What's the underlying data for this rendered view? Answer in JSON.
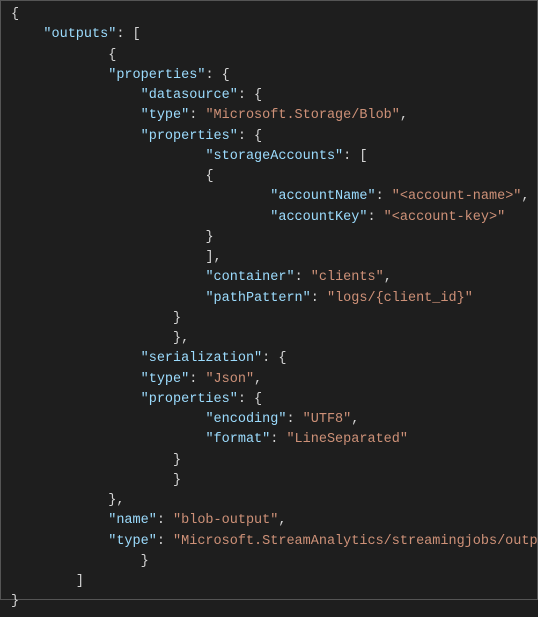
{
  "code": {
    "lines": [
      {
        "indent": 0,
        "tokens": [
          {
            "t": "{",
            "c": "punct"
          }
        ]
      },
      {
        "indent": 1,
        "tokens": [
          {
            "t": "\"outputs\"",
            "c": "key"
          },
          {
            "t": ": [",
            "c": "punct"
          }
        ]
      },
      {
        "indent": 3,
        "tokens": [
          {
            "t": "{",
            "c": "punct"
          }
        ]
      },
      {
        "indent": 3,
        "tokens": [
          {
            "t": "\"properties\"",
            "c": "key"
          },
          {
            "t": ": {",
            "c": "punct"
          }
        ]
      },
      {
        "indent": 4,
        "tokens": [
          {
            "t": "\"datasource\"",
            "c": "key"
          },
          {
            "t": ": {",
            "c": "punct"
          }
        ]
      },
      {
        "indent": 4,
        "tokens": [
          {
            "t": "\"type\"",
            "c": "key"
          },
          {
            "t": ": ",
            "c": "punct"
          },
          {
            "t": "\"Microsoft.Storage/Blob\"",
            "c": "str"
          },
          {
            "t": ",",
            "c": "punct"
          }
        ]
      },
      {
        "indent": 4,
        "tokens": [
          {
            "t": "\"properties\"",
            "c": "key"
          },
          {
            "t": ": {",
            "c": "punct"
          }
        ]
      },
      {
        "indent": 6,
        "tokens": [
          {
            "t": "\"storageAccounts\"",
            "c": "key"
          },
          {
            "t": ": [",
            "c": "punct"
          }
        ]
      },
      {
        "indent": 6,
        "tokens": [
          {
            "t": "{",
            "c": "punct"
          }
        ]
      },
      {
        "indent": 8,
        "tokens": [
          {
            "t": "\"accountName\"",
            "c": "key"
          },
          {
            "t": ": ",
            "c": "punct"
          },
          {
            "t": "\"<account-name>\"",
            "c": "str"
          },
          {
            "t": ",",
            "c": "punct"
          }
        ]
      },
      {
        "indent": 8,
        "tokens": [
          {
            "t": "\"accountKey\"",
            "c": "key"
          },
          {
            "t": ": ",
            "c": "punct"
          },
          {
            "t": "\"<account-key>\"",
            "c": "str"
          }
        ]
      },
      {
        "indent": 6,
        "tokens": [
          {
            "t": "}",
            "c": "punct"
          }
        ]
      },
      {
        "indent": 6,
        "tokens": [
          {
            "t": "],",
            "c": "punct"
          }
        ]
      },
      {
        "indent": 6,
        "tokens": [
          {
            "t": "\"container\"",
            "c": "key"
          },
          {
            "t": ": ",
            "c": "punct"
          },
          {
            "t": "\"clients\"",
            "c": "str"
          },
          {
            "t": ",",
            "c": "punct"
          }
        ]
      },
      {
        "indent": 6,
        "tokens": [
          {
            "t": "\"pathPattern\"",
            "c": "key"
          },
          {
            "t": ": ",
            "c": "punct"
          },
          {
            "t": "\"logs/{client_id}\"",
            "c": "str"
          }
        ]
      },
      {
        "indent": 5,
        "tokens": [
          {
            "t": "}",
            "c": "punct"
          }
        ]
      },
      {
        "indent": 5,
        "tokens": [
          {
            "t": "},",
            "c": "punct"
          }
        ]
      },
      {
        "indent": 4,
        "tokens": [
          {
            "t": "\"serialization\"",
            "c": "key"
          },
          {
            "t": ": {",
            "c": "punct"
          }
        ]
      },
      {
        "indent": 4,
        "tokens": [
          {
            "t": "\"type\"",
            "c": "key"
          },
          {
            "t": ": ",
            "c": "punct"
          },
          {
            "t": "\"Json\"",
            "c": "str"
          },
          {
            "t": ",",
            "c": "punct"
          }
        ]
      },
      {
        "indent": 4,
        "tokens": [
          {
            "t": "\"properties\"",
            "c": "key"
          },
          {
            "t": ": {",
            "c": "punct"
          }
        ]
      },
      {
        "indent": 6,
        "tokens": [
          {
            "t": "\"encoding\"",
            "c": "key"
          },
          {
            "t": ": ",
            "c": "punct"
          },
          {
            "t": "\"UTF8\"",
            "c": "str"
          },
          {
            "t": ",",
            "c": "punct"
          }
        ]
      },
      {
        "indent": 6,
        "tokens": [
          {
            "t": "\"format\"",
            "c": "key"
          },
          {
            "t": ": ",
            "c": "punct"
          },
          {
            "t": "\"LineSeparated\"",
            "c": "str"
          }
        ]
      },
      {
        "indent": 5,
        "tokens": [
          {
            "t": "}",
            "c": "punct"
          }
        ]
      },
      {
        "indent": 5,
        "tokens": [
          {
            "t": "}",
            "c": "punct"
          }
        ]
      },
      {
        "indent": 3,
        "tokens": [
          {
            "t": "},",
            "c": "punct"
          }
        ]
      },
      {
        "indent": 3,
        "tokens": [
          {
            "t": "\"name\"",
            "c": "key"
          },
          {
            "t": ": ",
            "c": "punct"
          },
          {
            "t": "\"blob-output\"",
            "c": "str"
          },
          {
            "t": ",",
            "c": "punct"
          }
        ]
      },
      {
        "indent": 3,
        "tokens": [
          {
            "t": "\"type\"",
            "c": "key"
          },
          {
            "t": ": ",
            "c": "punct"
          },
          {
            "t": "\"Microsoft.StreamAnalytics/streamingjobs/outputs\"",
            "c": "str"
          }
        ]
      },
      {
        "indent": 4,
        "tokens": [
          {
            "t": "}",
            "c": "punct"
          }
        ]
      },
      {
        "indent": 2,
        "tokens": [
          {
            "t": "]",
            "c": "punct"
          }
        ]
      },
      {
        "indent": 0,
        "tokens": [
          {
            "t": "}",
            "c": "punct"
          }
        ]
      }
    ]
  },
  "indent_unit": "    "
}
